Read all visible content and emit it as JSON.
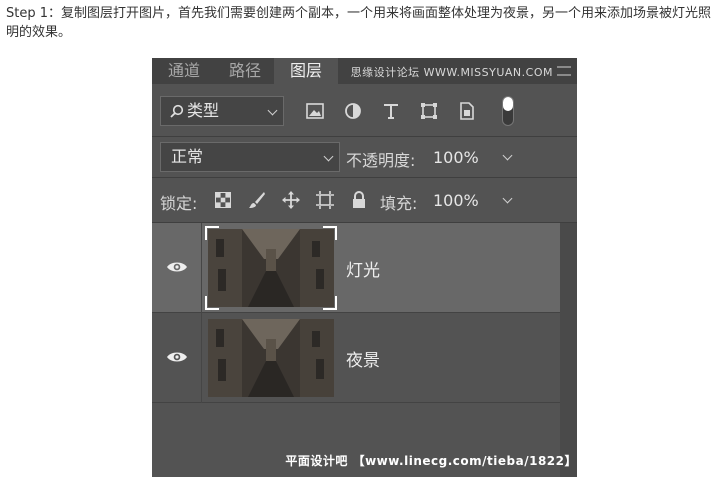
{
  "article": {
    "text": "Step 1：复制图层打开图片，首先我们需要创建两个副本，一个用来将画面整体处理为夜景，另一个用来添加场景被灯光照明的效果。"
  },
  "panel": {
    "tabs": [
      {
        "label": "通道",
        "active": false
      },
      {
        "label": "路径",
        "active": false
      },
      {
        "label": "图层",
        "active": true
      }
    ],
    "watermark_top": "思缘设计论坛 WWW.MISSYUAN.COM",
    "filter": {
      "kind_label": "类型",
      "icons": [
        "image-filter-icon",
        "adjustment-filter-icon",
        "type-filter-icon",
        "shape-filter-icon",
        "smart-object-filter-icon"
      ]
    },
    "blend": {
      "mode": "正常",
      "opacity_label": "不透明度:",
      "opacity_value": "100%"
    },
    "lock": {
      "label": "锁定:",
      "fill_label": "填充:",
      "fill_value": "100%"
    },
    "layers": [
      {
        "name": "灯光",
        "selected": true,
        "visible": true
      },
      {
        "name": "夜景",
        "selected": false,
        "visible": true
      }
    ],
    "watermark_bottom": "平面设计吧 【www.linecg.com/tieba/1822】"
  },
  "colors": {
    "panel_bg": "#535353",
    "tab_bar_bg": "#424242",
    "selected_layer_bg": "#686868",
    "text": "#e6e6e6"
  }
}
